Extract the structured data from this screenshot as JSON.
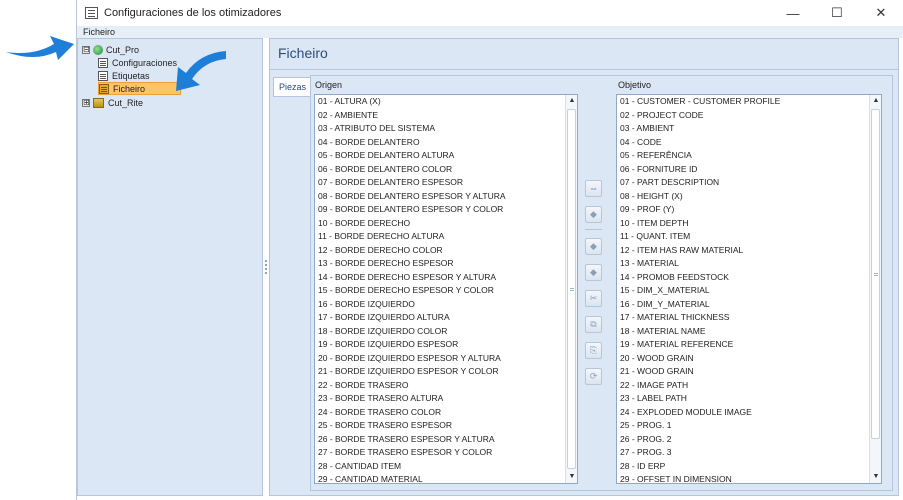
{
  "window": {
    "title": "Configuraciones de los otimizadores",
    "minimize": "—",
    "maximize": "☐",
    "close": "✕"
  },
  "menu": {
    "file": "Ficheiro"
  },
  "tree": {
    "root": {
      "label": "Cut_Pro",
      "expander": "⊟"
    },
    "children": [
      {
        "label": "Configuraciones"
      },
      {
        "label": "Etiquetas"
      },
      {
        "label": "Ficheiro"
      }
    ],
    "second": {
      "label": "Cut_Rite",
      "expander": "⊞"
    }
  },
  "page": {
    "title": "Ficheiro",
    "tab": "Piezas",
    "source_label": "Origen",
    "target_label": "Objetivo"
  },
  "source_items": [
    "01 - ALTURA (X)",
    "02 - AMBIENTE",
    "03 - ATRIBUTO DEL SISTEMA",
    "04 - BORDE DELANTERO",
    "05 - BORDE DELANTERO ALTURA",
    "06 - BORDE DELANTERO COLOR",
    "07 - BORDE DELANTERO ESPESOR",
    "08 - BORDE DELANTERO ESPESOR Y ALTURA",
    "09 - BORDE DELANTERO ESPESOR Y COLOR",
    "10 - BORDE DERECHO",
    "11 - BORDE DERECHO ALTURA",
    "12 - BORDE DERECHO COLOR",
    "13 - BORDE DERECHO ESPESOR",
    "14 - BORDE DERECHO ESPESOR Y ALTURA",
    "15 - BORDE DERECHO ESPESOR Y COLOR",
    "16 - BORDE IZQUIERDO",
    "17 - BORDE IZQUIERDO ALTURA",
    "18 - BORDE IZQUIERDO COLOR",
    "19 - BORDE IZQUIERDO ESPESOR",
    "20 - BORDE IZQUIERDO ESPESOR Y ALTURA",
    "21 - BORDE IZQUIERDO ESPESOR Y COLOR",
    "22 - BORDE TRASERO",
    "23 - BORDE TRASERO ALTURA",
    "24 - BORDE TRASERO COLOR",
    "25 - BORDE TRASERO ESPESOR",
    "26 - BORDE TRASERO ESPESOR Y ALTURA",
    "27 - BORDE TRASERO ESPESOR Y COLOR",
    "28 - CANTIDAD ITEM",
    "29 - CANTIDAD MATERIAL"
  ],
  "target_items": [
    "01 - CUSTOMER - CUSTOMER PROFILE",
    "02 - PROJECT CODE",
    "03 - AMBIENT",
    "04 - CODE",
    "05 - REFERÊNCIA",
    "06 - FORNITURE ID",
    "07 - PART DESCRIPTION",
    "08 - HEIGHT (X)",
    "09 - PROF (Y)",
    "10 - ITEM DEPTH",
    "11 - QUANT. ITEM",
    "12 - ITEM HAS RAW MATERIAL",
    "13 - MATERIAL",
    "14 - PROMOB FEEDSTOCK",
    "15 - DIM_X_MATERIAL",
    "16 - DIM_Y_MATERIAL",
    "17 - MATERIAL THICKNESS",
    "18 - MATERIAL NAME",
    "19 - MATERIAL REFERENCE",
    "20 - WOOD GRAIN",
    "21 - WOOD GRAIN",
    "22 - IMAGE PATH",
    "23 - LABEL PATH",
    "24 - EXPLODED MODULE IMAGE",
    "25 - PROG. 1",
    "26 - PROG. 2",
    "27 - PROG. 3",
    "28 - ID ERP",
    "29 - OFFSET IN DIMENSION"
  ],
  "buttons": {
    "link": "⇔",
    "add": "◆",
    "remove": "◆",
    "add_all": "◆",
    "cut": "✂",
    "copy": "⧉",
    "paste": "⎘",
    "refresh": "⟳"
  },
  "colors": {
    "pane_bg": "#dce7f5",
    "selection": "#fdc367",
    "arrow": "#1f7ed8"
  }
}
